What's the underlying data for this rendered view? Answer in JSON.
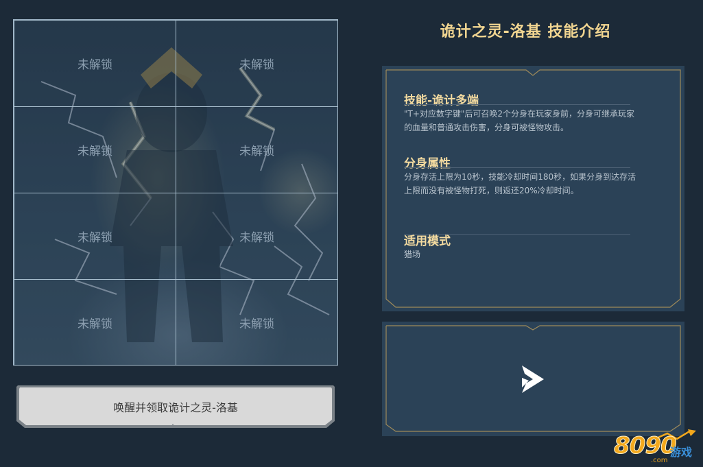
{
  "puzzle": {
    "cells": [
      {
        "label": "未解锁"
      },
      {
        "label": "未解锁"
      },
      {
        "label": "未解锁"
      },
      {
        "label": "未解锁"
      },
      {
        "label": "未解锁"
      },
      {
        "label": "未解锁"
      },
      {
        "label": "未解锁"
      },
      {
        "label": "未解锁"
      }
    ]
  },
  "awaken_button": {
    "label": "唤醒并领取诡计之灵-洛基"
  },
  "title": "诡计之灵-洛基  技能介绍",
  "skills": [
    {
      "title": "技能-诡计多端",
      "text": "\"T+对应数字键\"后可召唤2个分身在玩家身前，分身可继承玩家的血量和普通攻击伤害，分身可被怪物攻击。"
    },
    {
      "title": "分身属性",
      "text": "分身存活上限为10秒，技能冷却时间180秒，如果分身到达存活上限而没有被怪物打死，则返还20%冷却时间。"
    },
    {
      "title": "适用模式",
      "text": "猎场"
    }
  ],
  "video": {
    "icon": "play-icon"
  },
  "logo": {
    "brand": "8090",
    "sub": "游戏",
    "domain": ".com"
  },
  "colors": {
    "background": "#1c2a38",
    "panel": "#2b4257",
    "gold": "#f2d691",
    "frame_gold": "#9e8a5a"
  }
}
